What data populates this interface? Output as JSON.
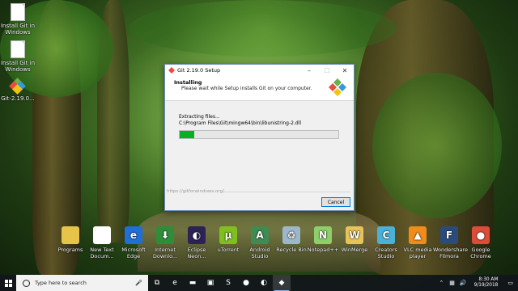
{
  "desktop_icons": [
    {
      "label": "Install Git in Windows",
      "type": "doc"
    },
    {
      "label": "Install Git in Windows",
      "type": "doc"
    },
    {
      "label": "Git-2.19.0...",
      "type": "git"
    }
  ],
  "bottom_icons": [
    {
      "label": "Programs",
      "color": "#e6c44a",
      "glyph": ""
    },
    {
      "label": "New Text Docum...",
      "color": "#ffffff",
      "glyph": ""
    },
    {
      "label": "Microsoft Edge",
      "color": "#1f6fd6",
      "glyph": "e"
    },
    {
      "label": "Internet Downlo...",
      "color": "#2f8d3a",
      "glyph": "⬇"
    },
    {
      "label": "Eclipse Neon...",
      "color": "#2c2255",
      "glyph": "◐"
    },
    {
      "label": "uTorrent",
      "color": "#7fbf1f",
      "glyph": "µ"
    },
    {
      "label": "Android Studio",
      "color": "#3e8c52",
      "glyph": "A"
    },
    {
      "label": "Recycle Bin",
      "color": "#9cb7c9",
      "glyph": "♻"
    },
    {
      "label": "Notepad++",
      "color": "#8fcf6a",
      "glyph": "N"
    },
    {
      "label": "WinMerge",
      "color": "#e8c35a",
      "glyph": "W"
    },
    {
      "label": "Creators Studio",
      "color": "#4ab1d8",
      "glyph": "C"
    },
    {
      "label": "VLC media player",
      "color": "#f08c1a",
      "glyph": "▲"
    },
    {
      "label": "Wondershare Filmora",
      "color": "#2a4c7c",
      "glyph": "F"
    },
    {
      "label": "Google Chrome",
      "color": "#dd4b39",
      "glyph": "●"
    }
  ],
  "dialog": {
    "title": "Git 2.19.0 Setup",
    "header_title": "Installing",
    "header_subtitle": "Please wait while Setup installs Git on your computer.",
    "status": "Extracting files...",
    "path": "C:\\Program Files\\Git\\mingw64\\bin\\libunistring-2.dll",
    "progress_percent": 9,
    "footer_link": "https://gitforwindows.org/",
    "cancel_label": "Cancel"
  },
  "taskbar": {
    "search_placeholder": "Type here to search",
    "apps": [
      {
        "name": "task-view",
        "glyph": "⧉"
      },
      {
        "name": "edge",
        "glyph": "e"
      },
      {
        "name": "file-explorer",
        "glyph": "▬"
      },
      {
        "name": "store",
        "glyph": "▣"
      },
      {
        "name": "sublime",
        "glyph": "S"
      },
      {
        "name": "chrome",
        "glyph": "●"
      },
      {
        "name": "eclipse",
        "glyph": "◐"
      },
      {
        "name": "git-setup",
        "glyph": "◆"
      }
    ],
    "time": "8:30 AM",
    "date": "9/19/2018"
  },
  "colors": {
    "accent": "#0078d7",
    "progress": "#06b025"
  }
}
